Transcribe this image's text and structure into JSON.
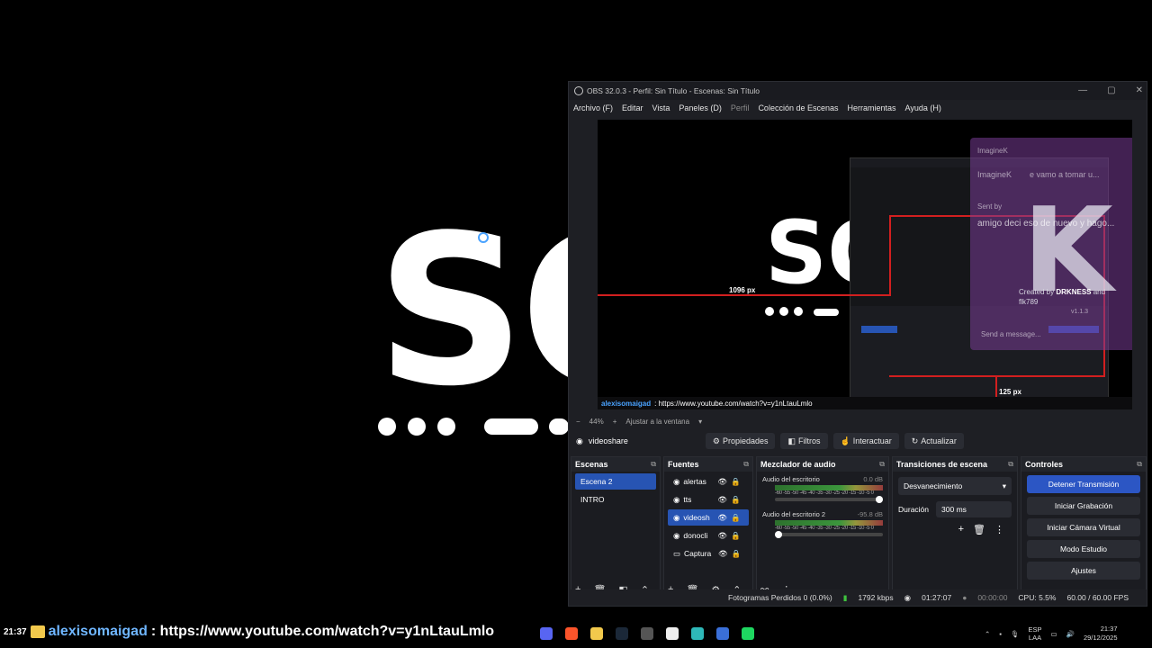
{
  "background": {
    "logo_text": "SO"
  },
  "obs": {
    "title": "OBS 32.0.3 - Perfil: Sin Título - Escenas: Sin Título",
    "window_buttons": [
      "—",
      "▢",
      "✕"
    ],
    "menu": [
      "Archivo (F)",
      "Editar",
      "Vista",
      "Paneles (D)",
      "Perfil",
      "Colección de Escenas",
      "Herramientas",
      "Ayuda (H)"
    ],
    "preview": {
      "width_label": "1096 px",
      "height_label": "125 px",
      "chat_user": "alexisomaigad",
      "chat_text": ": https://www.youtube.com/watch?v=y1nLtauLmlo",
      "overlay": {
        "app_name": "ImagineK",
        "line2": "e vamo a tomar u...",
        "sent_by": "Sent by",
        "message": "amigo deci eso de nuevo y hago...",
        "created_by": "Created by",
        "author1": "DRKNESS",
        "and": "and",
        "author2": "flk789",
        "version": "v1.1.3",
        "send_placeholder": "Send a message..."
      }
    },
    "zoom": {
      "percent": "44%",
      "fit_label": "Ajustar a la ventana"
    },
    "source_bar": {
      "current_source": "videoshare",
      "properties": "Propiedades",
      "filters": "Filtros",
      "interact": "Interactuar",
      "refresh": "Actualizar"
    },
    "scenes": {
      "title": "Escenas",
      "items": [
        {
          "label": "Escena 2",
          "active": true
        },
        {
          "label": "INTRO",
          "active": false
        }
      ]
    },
    "sources": {
      "title": "Fuentes",
      "items": [
        {
          "label": "alertas",
          "active": false
        },
        {
          "label": "tts",
          "active": false
        },
        {
          "label": "videosh",
          "active": true
        },
        {
          "label": "donocli",
          "active": false
        },
        {
          "label": "Captura",
          "active": false
        }
      ]
    },
    "mixer": {
      "title": "Mezclador de audio",
      "tracks": [
        {
          "name": "Audio del escritorio",
          "db": "0.0 dB",
          "volume": 1.0
        },
        {
          "name": "Audio del escritorio 2",
          "db": "-95.8 dB",
          "volume": 0.1
        }
      ],
      "ticks": "-60 -55 -50 -45 -40 -35 -30 -25 -20 -15 -10 -5 0"
    },
    "transitions": {
      "title": "Transiciones de escena",
      "selected": "Desvanecimiento",
      "duration_label": "Duración",
      "duration_value": "300 ms"
    },
    "controls": {
      "title": "Controles",
      "buttons": [
        "Detener Transmisión",
        "Iniciar Grabación",
        "Iniciar Cámara Virtual",
        "Modo Estudio",
        "Ajustes"
      ]
    },
    "status": {
      "dropped": "Fotogramas Perdidos 0 (0.0%)",
      "bitrate": "1792 kbps",
      "stream_time": "01:27:07",
      "rec_time": "00:00:00",
      "cpu": "CPU: 5.5%",
      "fps": "60.00 / 60.00 FPS"
    }
  },
  "chat": {
    "time": "21:37",
    "user": "alexisomaigad",
    "text": ": https://www.youtube.com/watch?v=y1nLtauLmlo"
  },
  "taskbar": {
    "lang_top": "ESP",
    "lang_bottom": "LAA",
    "time": "21:37",
    "date": "29/12/2025",
    "colors": {
      "accent": "#2754b3",
      "brand_green": "#1ed760"
    }
  }
}
